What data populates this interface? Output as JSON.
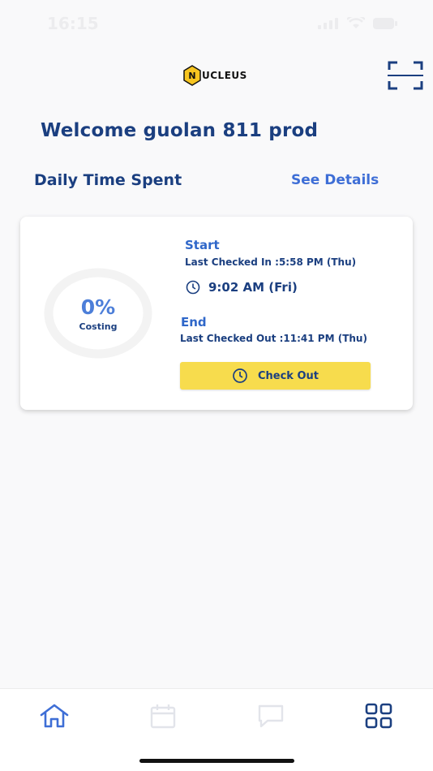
{
  "status_bar": {
    "time": "16:15"
  },
  "header": {
    "logo_text": "UCLEUS",
    "logo_badge": "N"
  },
  "welcome_text": "Welcome guolan 811 prod",
  "daily": {
    "title": "Daily Time Spent",
    "see_details": "See Details"
  },
  "card": {
    "percent": "0%",
    "percent_label": "Costing",
    "start_label": "Start",
    "last_checked_in": "Last Checked In :5:58 PM   (Thu)",
    "current_time": "9:02 AM   (Fri)",
    "end_label": "End",
    "last_checked_out": "Last Checked Out :11:41 PM   (Thu)",
    "checkout_button": "Check Out"
  },
  "nav": {
    "items": [
      {
        "icon": "home-icon",
        "active": true
      },
      {
        "icon": "calendar-icon",
        "active": false
      },
      {
        "icon": "chat-icon",
        "active": false
      },
      {
        "icon": "grid-icon",
        "active": true
      }
    ]
  },
  "colors": {
    "primary": "#1b3f80",
    "accent": "#3e6ed6",
    "button": "#f7dc4d"
  }
}
